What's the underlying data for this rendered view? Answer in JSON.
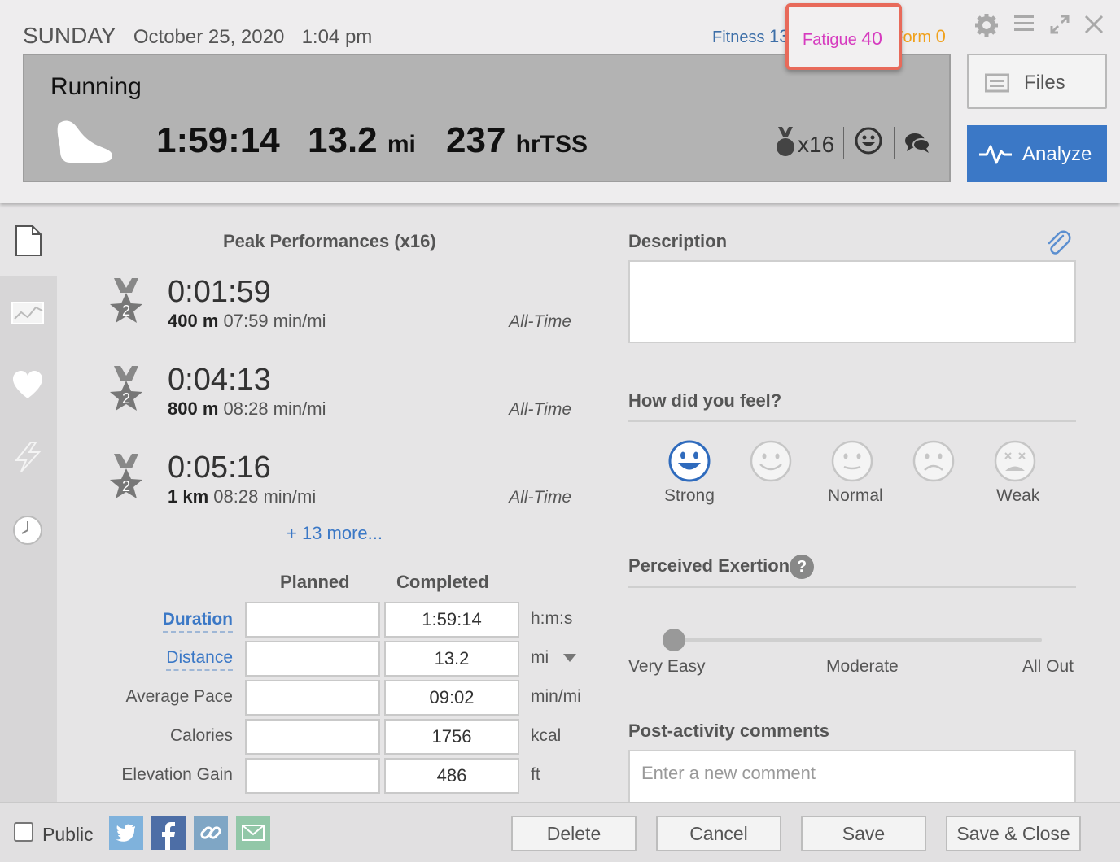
{
  "header": {
    "day": "SUNDAY",
    "date": "October 25, 2020",
    "time": "1:04 pm",
    "fitness_label": "Fitness",
    "fitness_value": "13",
    "fatigue_label": "Fatigue",
    "fatigue_value": "40",
    "form_label": "Form",
    "form_value": "0"
  },
  "activity": {
    "type": "Running",
    "duration": "1:59:14",
    "distance_value": "13.2",
    "distance_unit": "mi",
    "tss_value": "237",
    "tss_unit": "hrTSS",
    "medal_count": "x16"
  },
  "buttons": {
    "files": "Files",
    "analyze": "Analyze"
  },
  "peaks": {
    "title": "Peak Performances (x16)",
    "items": [
      {
        "rank": "2",
        "time": "0:01:59",
        "distance": "400 m",
        "pace": "07:59 min/mi",
        "scope": "All-Time"
      },
      {
        "rank": "2",
        "time": "0:04:13",
        "distance": "800 m",
        "pace": "08:28 min/mi",
        "scope": "All-Time"
      },
      {
        "rank": "2",
        "time": "0:05:16",
        "distance": "1 km",
        "pace": "08:28 min/mi",
        "scope": "All-Time"
      }
    ],
    "more": "+ 13 more..."
  },
  "summary": {
    "planned_header": "Planned",
    "completed_header": "Completed",
    "rows": [
      {
        "label": "Duration",
        "planned": "",
        "completed": "1:59:14",
        "unit": "h:m:s"
      },
      {
        "label": "Distance",
        "planned": "",
        "completed": "13.2",
        "unit": "mi"
      },
      {
        "label": "Average Pace",
        "planned": "",
        "completed": "09:02",
        "unit": "min/mi"
      },
      {
        "label": "Calories",
        "planned": "",
        "completed": "1756",
        "unit": "kcal"
      },
      {
        "label": "Elevation Gain",
        "planned": "",
        "completed": "486",
        "unit": "ft"
      }
    ]
  },
  "right": {
    "description_title": "Description",
    "feel_title": "How did you feel?",
    "feel_options": [
      "Strong",
      "",
      "Normal",
      "",
      "Weak"
    ],
    "exertion_title": "Perceived Exertion",
    "exertion_help": "?",
    "exertion_scale": [
      "Very Easy",
      "Moderate",
      "All Out"
    ],
    "exertion_level": 0,
    "comments_title": "Post-activity comments",
    "comment_placeholder": "Enter a new comment"
  },
  "footer": {
    "public_label": "Public",
    "delete": "Delete",
    "cancel": "Cancel",
    "save": "Save",
    "save_close": "Save & Close"
  },
  "colors": {
    "accent": "#3b78c6",
    "fitness": "#3d6fa8",
    "fatigue": "#d63bbf",
    "form": "#f0a11c",
    "highlight": "#e86a5a"
  }
}
